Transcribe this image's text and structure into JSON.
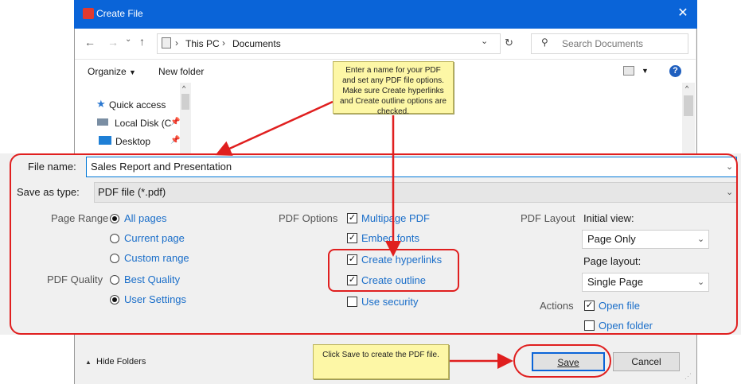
{
  "window": {
    "title": "Create File"
  },
  "address": {
    "path_root": "This PC",
    "path_folder": "Documents",
    "search_placeholder": "Search Documents"
  },
  "toolbar": {
    "organize": "Organize",
    "new_folder": "New folder"
  },
  "nav": {
    "items": [
      {
        "label": "Quick access",
        "icon": "star-icon"
      },
      {
        "label": "Local Disk (C",
        "icon": "drive-icon"
      },
      {
        "label": "Desktop",
        "icon": "desktop-icon"
      }
    ]
  },
  "form": {
    "file_name_label": "File name:",
    "file_name_value": "Sales Report and Presentation",
    "save_as_label": "Save as type:",
    "save_as_value": "PDF file (*.pdf)"
  },
  "options": {
    "page_range_label": "Page Range",
    "page_range": [
      {
        "label": "All pages",
        "selected": true
      },
      {
        "label": "Current page",
        "selected": false
      },
      {
        "label": "Custom range",
        "selected": false
      }
    ],
    "pdf_quality_label": "PDF Quality",
    "pdf_quality": [
      {
        "label": "Best Quality",
        "selected": false
      },
      {
        "label": "User Settings",
        "selected": true
      }
    ],
    "pdf_options_label": "PDF Options",
    "pdf_options": [
      {
        "label": "Multipage PDF",
        "checked": true
      },
      {
        "label": "Embed fonts",
        "checked": true
      },
      {
        "label": "Create hyperlinks",
        "checked": true
      },
      {
        "label": "Create outline",
        "checked": true
      },
      {
        "label": "Use security",
        "checked": false
      }
    ],
    "pdf_layout_label": "PDF Layout",
    "initial_view_label": "Initial view:",
    "initial_view_value": "Page Only",
    "page_layout_label": "Page layout:",
    "page_layout_value": "Single Page",
    "actions_label": "Actions",
    "actions": [
      {
        "label": "Open file",
        "checked": true
      },
      {
        "label": "Open folder",
        "checked": false
      }
    ]
  },
  "bottom": {
    "hide_folders": "Hide Folders",
    "save": "Save",
    "cancel": "Cancel"
  },
  "callouts": {
    "top": "Enter a name for your PDF and set any PDF file options. Make sure Create hyperlinks and Create outline options are checked.",
    "bottom": "Click Save to create the PDF file."
  },
  "colors": {
    "titlebar": "#0a64d8",
    "link": "#1a6ec9",
    "annotation": "#e01f1f",
    "callout": "#fdf7a6"
  }
}
